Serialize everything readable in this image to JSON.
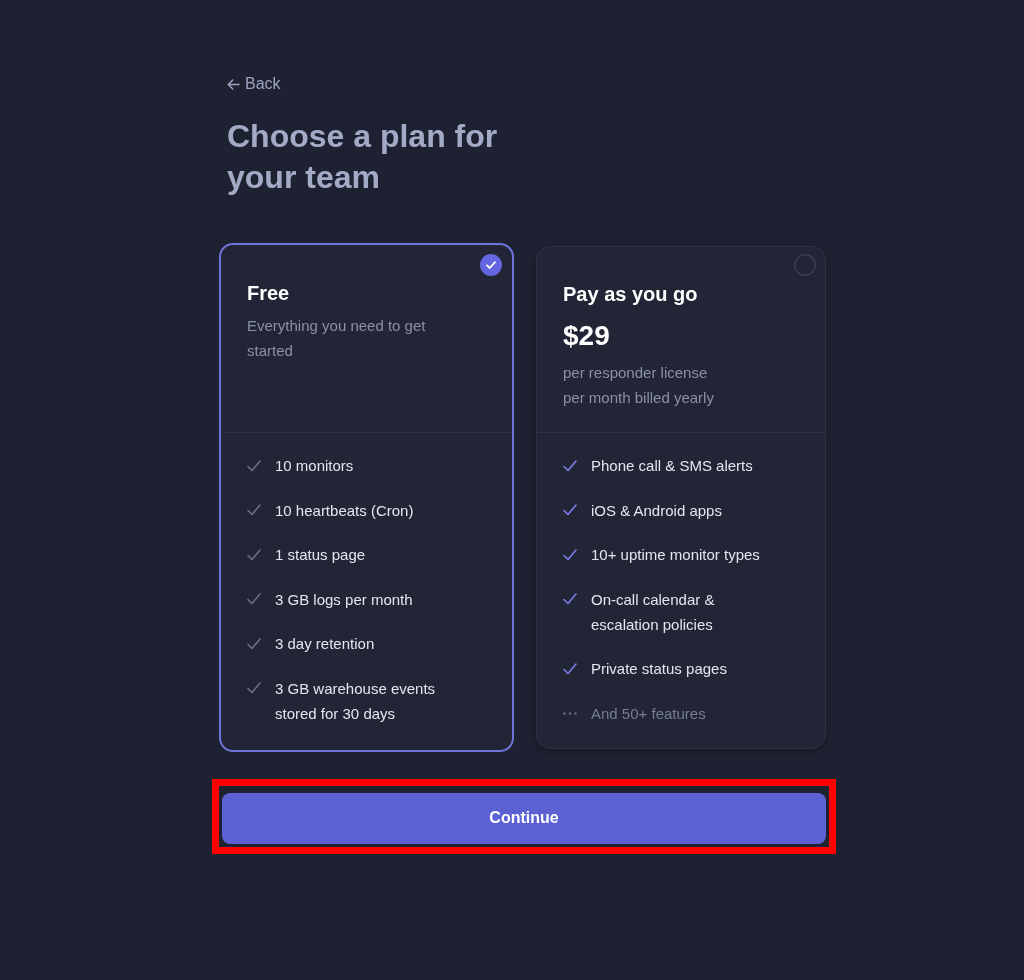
{
  "back_link": {
    "label": "Back"
  },
  "title": "Choose a **plan** for your team",
  "plans": [
    {
      "name": "Free",
      "selected": true,
      "description": "Everything you need to get started",
      "features": [
        {
          "kind": "muted",
          "label": "10 monitors"
        },
        {
          "kind": "muted",
          "label": "10 heartbeats (Cron)"
        },
        {
          "kind": "muted",
          "label": "1 status page"
        },
        {
          "kind": "muted",
          "label": "3 GB logs per month"
        },
        {
          "kind": "muted",
          "label": "3 day retention"
        },
        {
          "kind": "muted",
          "label": "3 GB warehouse events stored for 30 days"
        }
      ]
    },
    {
      "name": "Pay as you go",
      "selected": false,
      "price": "$29",
      "price_notes": [
        "per responder license",
        "per month billed yearly"
      ],
      "features": [
        {
          "kind": "accent",
          "label": "Phone call & SMS alerts"
        },
        {
          "kind": "accent",
          "label": "iOS & Android apps"
        },
        {
          "kind": "accent",
          "label": "10+ uptime monitor types"
        },
        {
          "kind": "accent",
          "label": "On-call calendar & escalation policies"
        },
        {
          "kind": "accent",
          "label": "Private status pages"
        },
        {
          "kind": "more",
          "label": "And 50+ features"
        }
      ]
    }
  ],
  "continue_button": {
    "label": "Continue",
    "highlighted": true
  }
}
